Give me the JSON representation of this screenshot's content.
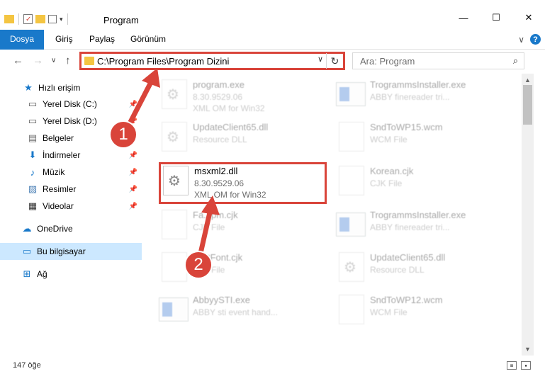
{
  "window": {
    "title": "Program",
    "minimize_glyph": "—",
    "maximize_glyph": "☐",
    "close_glyph": "✕"
  },
  "ribbon": {
    "tabs": [
      "Dosya",
      "Giriş",
      "Paylaş",
      "Görünüm"
    ],
    "expand_glyph": "∨",
    "help_glyph": "?"
  },
  "nav": {
    "back_glyph": "←",
    "forward_glyph": "→",
    "recent_glyph": "∨",
    "up_glyph": "↑",
    "address": "C:\\Program Files\\Program Dizini",
    "address_chevron": "∨",
    "refresh_glyph": "↻",
    "search_placeholder": "Ara: Program",
    "search_glyph": "⌕"
  },
  "sidebar": {
    "items": [
      {
        "label": "Hızlı erişim",
        "icon": "star-icon",
        "glyph": "★",
        "color": "#1979ca"
      },
      {
        "label": "Yerel Disk (C:)",
        "icon": "drive-icon",
        "glyph": "▭",
        "color": "#555555"
      },
      {
        "label": "Yerel Disk (D:)",
        "icon": "drive-icon",
        "glyph": "▭",
        "color": "#555555"
      },
      {
        "label": "Belgeler",
        "icon": "documents-icon",
        "glyph": "▤",
        "color": "#6d6d6d"
      },
      {
        "label": "İndirmeler",
        "icon": "download-icon",
        "glyph": "⬇",
        "color": "#1979ca"
      },
      {
        "label": "Müzik",
        "icon": "music-icon",
        "glyph": "♪",
        "color": "#1979ca"
      },
      {
        "label": "Resimler",
        "icon": "pictures-icon",
        "glyph": "▨",
        "color": "#4a7fb5"
      },
      {
        "label": "Videolar",
        "icon": "videos-icon",
        "glyph": "▦",
        "color": "#333333"
      },
      {
        "label": "OneDrive",
        "icon": "cloud-icon",
        "glyph": "☁",
        "color": "#1979ca"
      },
      {
        "label": "Bu bilgisayar",
        "icon": "computer-icon",
        "glyph": "▭",
        "color": "#1979ca"
      },
      {
        "label": "Ağ",
        "icon": "network-icon",
        "glyph": "⊞",
        "color": "#1979ca"
      }
    ],
    "pin_glyph": "📌"
  },
  "files": [
    {
      "name": "program.exe",
      "line2": "8.30.9529.06",
      "line3": "XML OM for Win32",
      "type": "gear"
    },
    {
      "name": "TrogrammsInstaller.exe",
      "line2": "ABBY finereader tri...",
      "line3": "",
      "type": "exe"
    },
    {
      "name": "UpdateClient65.dll",
      "line2": "Resource DLL",
      "line3": "",
      "type": "gear"
    },
    {
      "name": "SndToWP15.wcm",
      "line2": "WCM File",
      "line3": "",
      "type": "doc"
    },
    {
      "name": "msxml2.dll",
      "line2": "8.30.9529.06",
      "line3": "XML OM for Win32",
      "type": "gear"
    },
    {
      "name": "Korean.cjk",
      "line2": "CJK File",
      "line3": "",
      "type": "doc"
    },
    {
      "name": "Fa...pm.cjk",
      "line2": "CJK File",
      "line3": "",
      "type": "doc"
    },
    {
      "name": "TrogrammsInstaller.exe",
      "line2": "ABBY finereader tri...",
      "line3": "",
      "type": "exe"
    },
    {
      "name": "...ultFont.cjk",
      "line2": "CJK File",
      "line3": "",
      "type": "doc"
    },
    {
      "name": "UpdateClient65.dll",
      "line2": "Resource DLL",
      "line3": "",
      "type": "gear"
    },
    {
      "name": "AbbyySTI.exe",
      "line2": "ABBY sti event hand...",
      "line3": "",
      "type": "exe"
    },
    {
      "name": "SndToWP12.wcm",
      "line2": "WCM File",
      "line3": "",
      "type": "doc"
    }
  ],
  "callouts": [
    "1",
    "2"
  ],
  "status": {
    "count": "147 öğe",
    "details_view_glyph": "≡",
    "icons_view_glyph": "▪"
  },
  "colors": {
    "accent": "#1979ca",
    "highlight": "#d9443a",
    "selected": "#cce8ff"
  }
}
